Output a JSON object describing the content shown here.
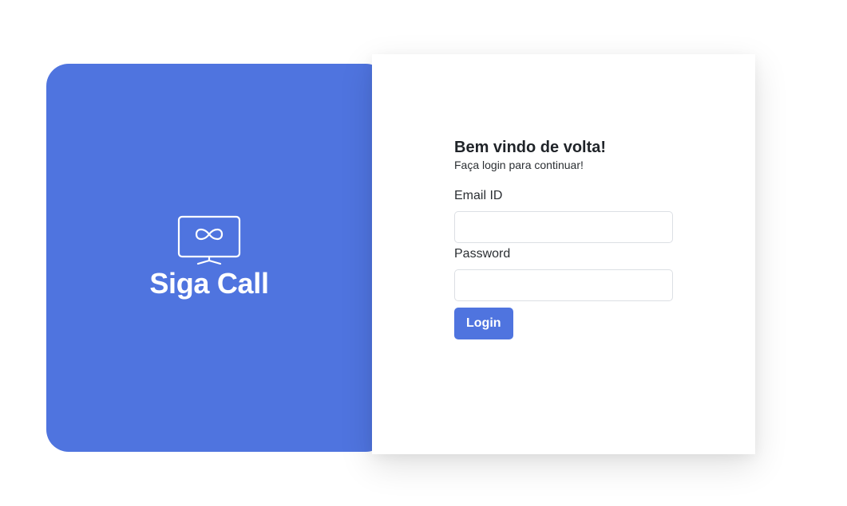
{
  "brand": {
    "name": "Siga Call",
    "logo_icon": "infinity-monitor-icon",
    "panel_color": "#4f74df"
  },
  "login": {
    "title": "Bem vindo de volta!",
    "subtitle": "Faça login para continuar!",
    "email": {
      "label": "Email ID",
      "value": "",
      "placeholder": ""
    },
    "password": {
      "label": "Password",
      "value": "",
      "placeholder": ""
    },
    "submit_label": "Login",
    "button_color": "#4f74df"
  }
}
